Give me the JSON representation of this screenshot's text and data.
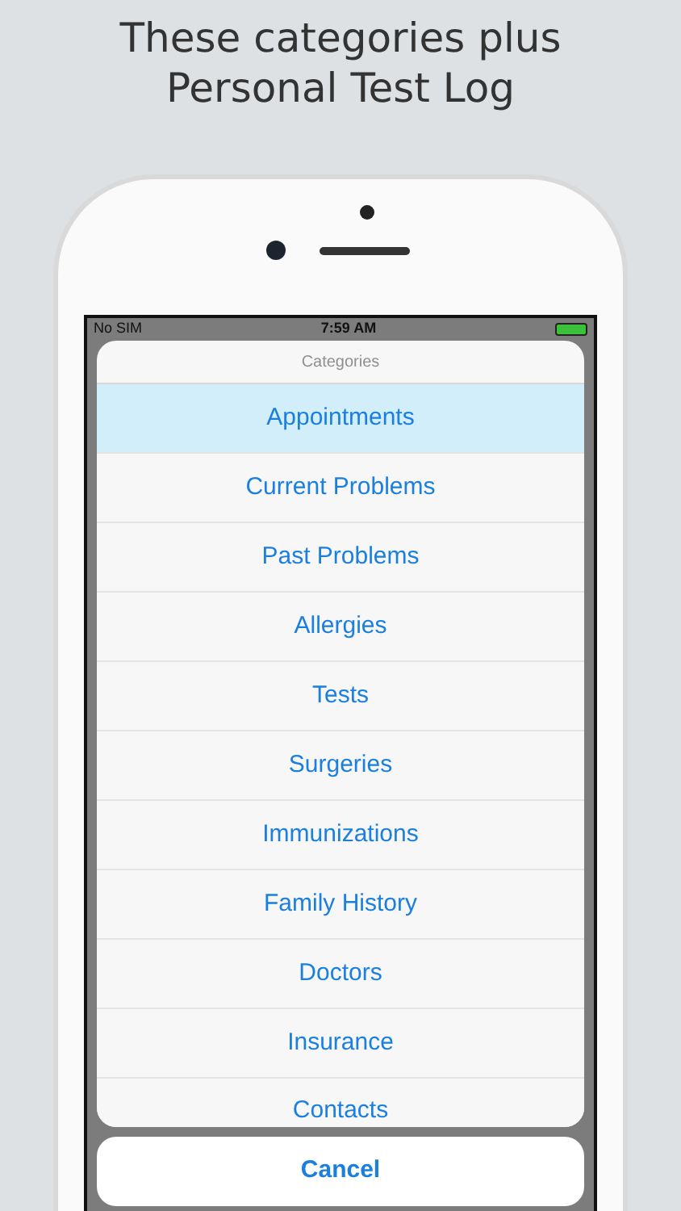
{
  "caption": [
    "These categories plus",
    "Personal Test Log"
  ],
  "status_bar": {
    "carrier": "No SIM",
    "time": "7:59 AM"
  },
  "sheet": {
    "title": "Categories",
    "items": [
      {
        "label": "Appointments",
        "selected": true
      },
      {
        "label": "Current Problems",
        "selected": false
      },
      {
        "label": "Past Problems",
        "selected": false
      },
      {
        "label": "Allergies",
        "selected": false
      },
      {
        "label": "Tests",
        "selected": false
      },
      {
        "label": "Surgeries",
        "selected": false
      },
      {
        "label": "Immunizations",
        "selected": false
      },
      {
        "label": "Family History",
        "selected": false
      },
      {
        "label": "Doctors",
        "selected": false
      },
      {
        "label": "Insurance",
        "selected": false
      },
      {
        "label": "Contacts",
        "selected": false
      }
    ]
  },
  "cancel_button": "Cancel"
}
